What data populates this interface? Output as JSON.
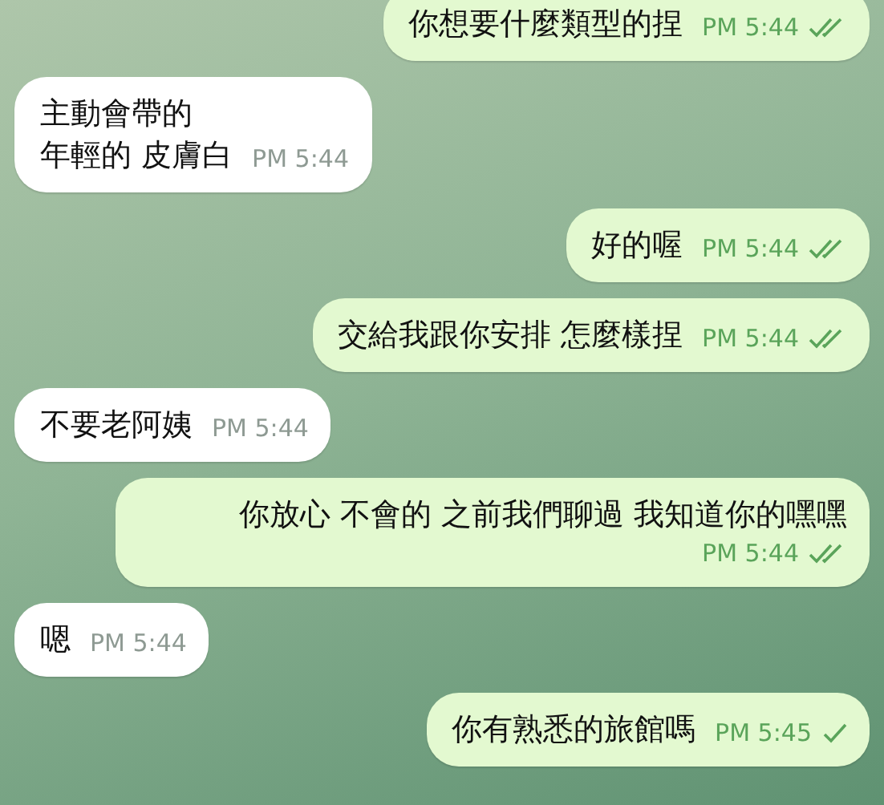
{
  "messages": [
    {
      "kind": "outgoing",
      "lines": [
        "你想要什麼類型的捏"
      ],
      "time": "PM 5:44",
      "read": true
    },
    {
      "kind": "incoming",
      "lines": [
        "主動會帶的",
        "年輕的 皮膚白"
      ],
      "time": "PM 5:44"
    },
    {
      "kind": "outgoing",
      "lines": [
        "好的喔"
      ],
      "time": "PM 5:44",
      "read": true
    },
    {
      "kind": "outgoing",
      "lines": [
        "交給我跟你安排 怎麼樣捏"
      ],
      "time": "PM 5:44",
      "read": true
    },
    {
      "kind": "incoming",
      "lines": [
        "不要老阿姨"
      ],
      "time": "PM 5:44"
    },
    {
      "kind": "outgoing",
      "lines": [
        "你放心 不會的 之前我們聊過 我知道你的嘿嘿"
      ],
      "time": "PM 5:44",
      "read": true
    },
    {
      "kind": "incoming",
      "lines": [
        "嗯"
      ],
      "time": "PM 5:44"
    },
    {
      "kind": "outgoing",
      "lines": [
        "你有熟悉的旅館嗎"
      ],
      "time": "PM 5:45",
      "read": false
    }
  ]
}
